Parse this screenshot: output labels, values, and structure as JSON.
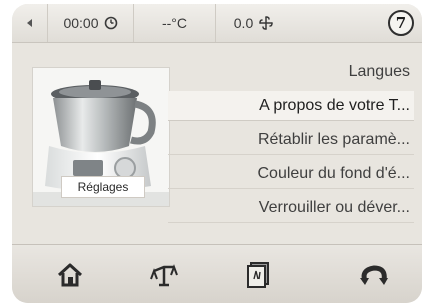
{
  "status_bar": {
    "back_icon": "left-arrow-icon",
    "time": "00:00",
    "time_icon": "clock-icon",
    "temperature": "--°C",
    "speed": "0.0",
    "speed_icon": "fan-blade-icon",
    "step_number": "7"
  },
  "thumbnail": {
    "label": "Réglages",
    "image": "thermomix-appliance"
  },
  "menu": {
    "items": [
      {
        "label": "Langues",
        "selected": false
      },
      {
        "label": "A propos de votre T...",
        "selected": true
      },
      {
        "label": "Rétablir les paramè...",
        "selected": false
      },
      {
        "label": "Couleur du fond d'é...",
        "selected": false
      },
      {
        "label": "Verrouiller ou déver...",
        "selected": false
      }
    ]
  },
  "bottom_bar": {
    "icons": [
      "home-icon",
      "scale-icon",
      "recipe-chip-icon",
      "turbo-reverse-icon"
    ]
  },
  "colors": {
    "background": "#e8e5df",
    "text": "#3f3f3f",
    "selected_row": "#f4f2ee"
  }
}
